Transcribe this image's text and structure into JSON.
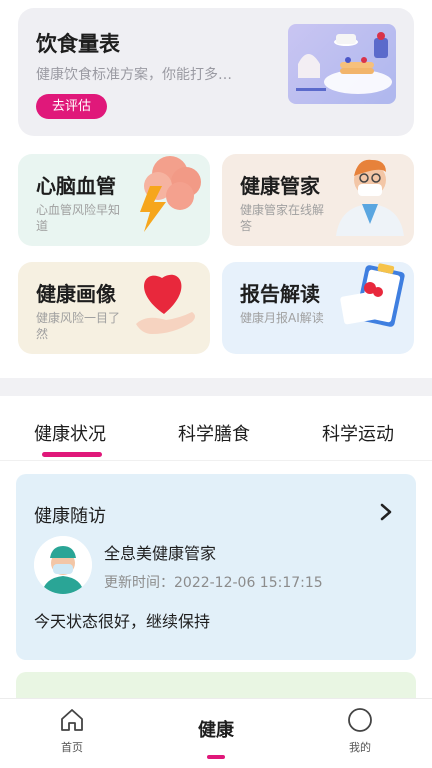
{
  "diet": {
    "title": "饮食量表",
    "subtitle": "健康饮食标准方案，你能打多…",
    "button_label": "去评估"
  },
  "features": [
    {
      "title": "心脑血管",
      "subtitle": "心血管风险早知道",
      "icon": "heart-brain-icon"
    },
    {
      "title": "健康管家",
      "subtitle": "健康管家在线解答",
      "icon": "doctor-icon"
    },
    {
      "title": "健康画像",
      "subtitle": "健康风险一目了然",
      "icon": "heart-hand-icon"
    },
    {
      "title": "报告解读",
      "subtitle": "健康月报AI解读",
      "icon": "report-clipboard-icon"
    }
  ],
  "tabs": [
    "健康状况",
    "科学膳食",
    "科学运动"
  ],
  "active_tab": "健康状况",
  "followup": {
    "title": "健康随访",
    "doctor_name": "全息美健康管家",
    "update_label": "更新时间：",
    "update_time": "2022-12-06 15:17:15",
    "status": "今天状态很好，继续保持"
  },
  "nav": {
    "home": "首页",
    "health": "健康",
    "mine": "我的"
  },
  "colors": {
    "accent": "#e0187a",
    "card_bg": "#efeff3",
    "followup_bg": "#e2f0f9"
  }
}
